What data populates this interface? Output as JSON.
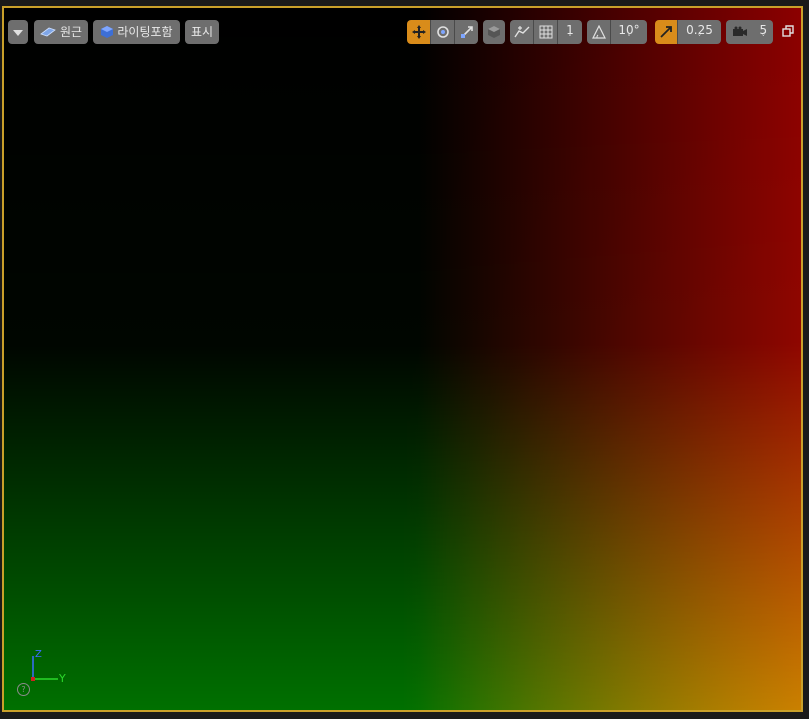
{
  "toolbar": {
    "menu_icon": "chevron-down-icon",
    "view_mode": {
      "label": "원근",
      "icon": "perspective-icon"
    },
    "lighting_mode": {
      "label": "라이팅포함",
      "icon": "lit-cube-icon"
    },
    "show": {
      "label": "표시"
    },
    "grid_snap": {
      "value": "1"
    },
    "rotation_snap": {
      "value": "10°"
    },
    "scale_snap": {
      "value": "0.25"
    },
    "camera_speed": {
      "value": "5"
    }
  },
  "axis_indicator": {
    "z": "Z",
    "y": "Y",
    "help": "?"
  },
  "colors": {
    "accent": "#d98c1a",
    "frame": "#c9a02a",
    "button_bg": "#6e6e6e"
  }
}
